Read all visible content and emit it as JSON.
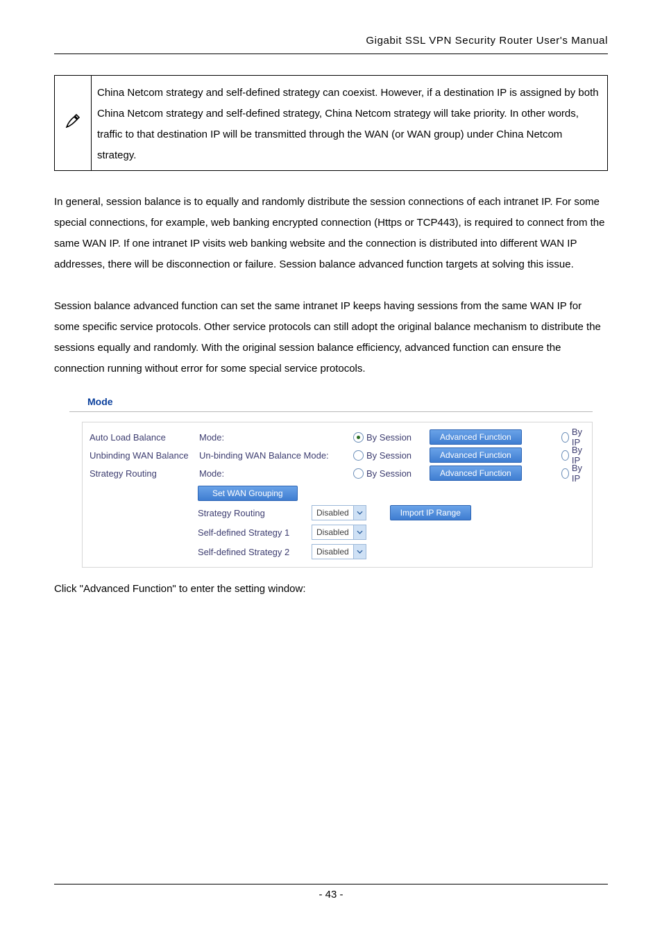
{
  "header": {
    "title": "Gigabit SSL VPN Security Router User's Manual"
  },
  "note": {
    "text": "China Netcom strategy and self-defined strategy can coexist. However, if a destination IP is assigned by both China Netcom strategy and self-defined strategy, China Netcom strategy will take priority. In other words, traffic to that destination IP will be transmitted through the WAN (or WAN group) under China Netcom strategy."
  },
  "para1": "In general, session balance is to equally and randomly distribute the session connections of each intranet IP. For some special connections, for example, web banking encrypted connection (Https or TCP443), is required to connect from the same WAN IP. If one intranet IP visits web banking website and the connection is distributed into different WAN IP addresses, there will be disconnection or failure. Session balance advanced function targets at solving this issue.",
  "para2": "Session balance advanced function can set the same intranet IP keeps having sessions from the same WAN IP for some specific service protocols. Other service protocols can still adopt the original balance mechanism to distribute the sessions equally and randomly. With the original session balance efficiency, advanced function can ensure the connection running without error for some special service protocols.",
  "mode": {
    "heading": "Mode",
    "rows": [
      {
        "label": "Auto Load Balance",
        "desc": "Mode:",
        "by_session": "By Session",
        "adv": "Advanced Function",
        "by_ip": "By IP",
        "selected": true
      },
      {
        "label": "Unbinding WAN Balance",
        "desc": "Un-binding WAN Balance Mode:",
        "by_session": "By Session",
        "adv": "Advanced Function",
        "by_ip": "By IP",
        "selected": false
      },
      {
        "label": "Strategy Routing",
        "desc": "Mode:",
        "by_session": "By Session",
        "adv": "Advanced Function",
        "by_ip": "By IP",
        "selected": false
      }
    ],
    "set_wan_grouping": "Set WAN Grouping",
    "import_ip_range": "Import IP Range",
    "sub": [
      {
        "label": "Strategy Routing",
        "value": "Disabled"
      },
      {
        "label": "Self-defined Strategy 1",
        "value": "Disabled"
      },
      {
        "label": "Self-defined Strategy 2",
        "value": "Disabled"
      }
    ]
  },
  "after_panel": "Click \"Advanced Function\" to enter the setting window:",
  "footer": {
    "page": "- 43 -"
  }
}
